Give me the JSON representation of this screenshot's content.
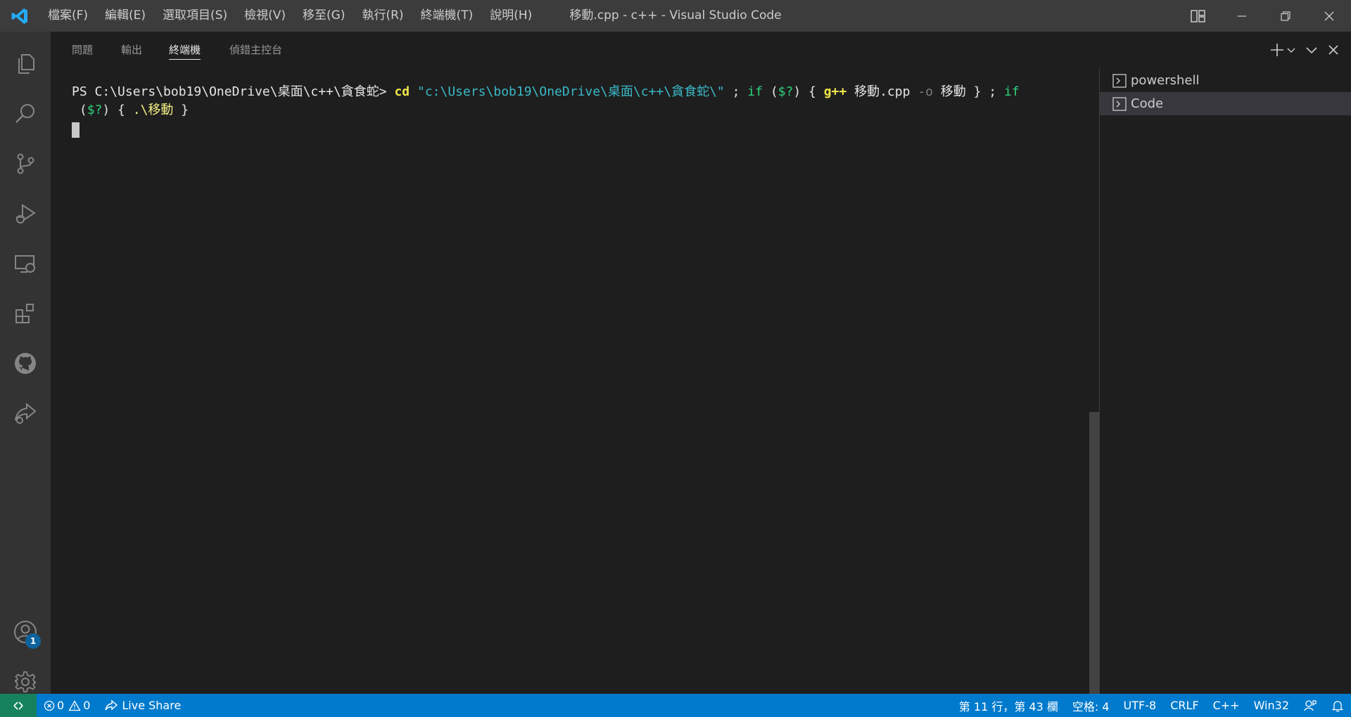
{
  "window": {
    "title": "移動.cpp - c++ - Visual Studio Code"
  },
  "menu": [
    {
      "id": "file",
      "label": "檔案(F)"
    },
    {
      "id": "edit",
      "label": "編輯(E)"
    },
    {
      "id": "selection",
      "label": "選取項目(S)"
    },
    {
      "id": "view",
      "label": "檢視(V)"
    },
    {
      "id": "go",
      "label": "移至(G)"
    },
    {
      "id": "run",
      "label": "執行(R)"
    },
    {
      "id": "terminal",
      "label": "終端機(T)"
    },
    {
      "id": "help",
      "label": "說明(H)"
    }
  ],
  "activity_bar": {
    "icons": [
      "explorer-icon",
      "search-icon",
      "source-control-icon",
      "run-debug-icon",
      "remote-explorer-icon",
      "extensions-icon",
      "github-icon",
      "live-share-icon",
      "accounts-icon",
      "settings-gear-icon"
    ],
    "accounts_badge": "1"
  },
  "panel": {
    "tabs": [
      {
        "id": "problems",
        "label": "問題"
      },
      {
        "id": "output",
        "label": "輸出"
      },
      {
        "id": "terminal",
        "label": "終端機"
      },
      {
        "id": "debug_console",
        "label": "偵錯主控台"
      }
    ],
    "active_tab": "terminal"
  },
  "terminal": {
    "line1": {
      "prompt": "PS C:\\Users\\bob19\\OneDrive\\桌面\\c++\\貪食蛇> ",
      "cd": "cd",
      "path": " \"c:\\Users\\bob19\\OneDrive\\桌面\\c++\\貪食蛇\\\"",
      "semi1": " ; ",
      "if1": "if",
      "cond1a": " (",
      "cond1b": "$?",
      "cond1c": ") { ",
      "gpp": "g++",
      "file": " 移動.cpp ",
      "flag": "-o",
      "out": " 移動 } ; ",
      "if2": "if"
    },
    "line2": {
      "open": " (",
      "cond": "$?",
      "close": ") { ",
      "exe": ".\\移動",
      "end": " }"
    }
  },
  "terminal_list": [
    {
      "label": "powershell",
      "selected": false
    },
    {
      "label": "Code",
      "selected": true
    }
  ],
  "statusbar": {
    "errors": "0",
    "warnings": "0",
    "live_share": "Live Share",
    "position": "第 11 行，第 43 欄",
    "indent": "空格: 4",
    "encoding": "UTF-8",
    "eol": "CRLF",
    "language": "C++",
    "platform": "Win32"
  }
}
